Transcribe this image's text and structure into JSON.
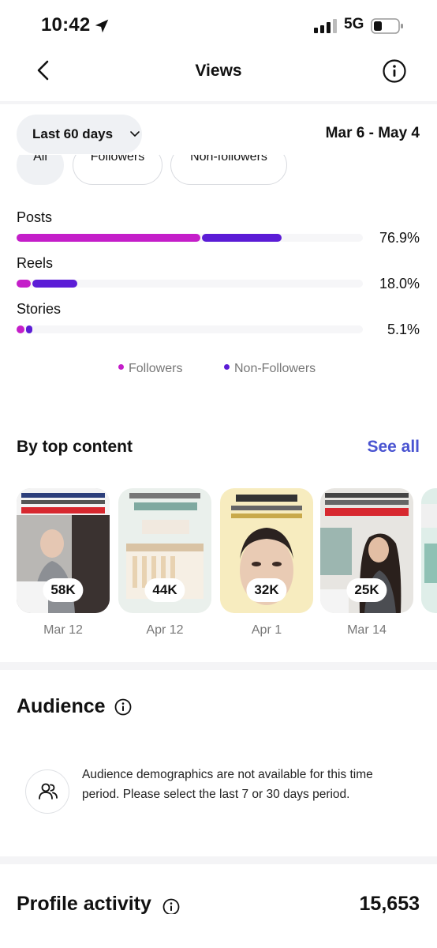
{
  "status_bar": {
    "time": "10:42",
    "network": "5G"
  },
  "nav": {
    "title": "Views"
  },
  "date_filter": {
    "label": "Last 60 days",
    "range": "Mar 6 - May 4"
  },
  "audience_filters": [
    "All",
    "Followers",
    "Non-followers"
  ],
  "breakdown": [
    {
      "label": "Posts",
      "followers": 0.535,
      "non_followers": 0.234,
      "percent": "76.9%"
    },
    {
      "label": "Reels",
      "followers": 0.045,
      "non_followers": 0.135,
      "percent": "18.0%"
    },
    {
      "label": "Stories",
      "followers": 0.027,
      "non_followers": 0.024,
      "percent": "5.1%"
    }
  ],
  "legend": {
    "followers": "Followers",
    "non_followers": "Non-Followers"
  },
  "colors": {
    "followers": "#c41ec9",
    "non_followers": "#5b1cd6",
    "link": "#4a54d1"
  },
  "top_content": {
    "title": "By top content",
    "see_all": "See all",
    "items": [
      {
        "views": "58K",
        "date": "Mar 12"
      },
      {
        "views": "44K",
        "date": "Apr 12"
      },
      {
        "views": "32K",
        "date": "Apr 1"
      },
      {
        "views": "25K",
        "date": "Mar 14"
      }
    ]
  },
  "audience": {
    "title": "Audience",
    "message": "Audience demographics are not available for this time period. Please select the last 7 or 30 days period."
  },
  "profile_activity": {
    "title": "Profile activity",
    "value": "15,653"
  }
}
